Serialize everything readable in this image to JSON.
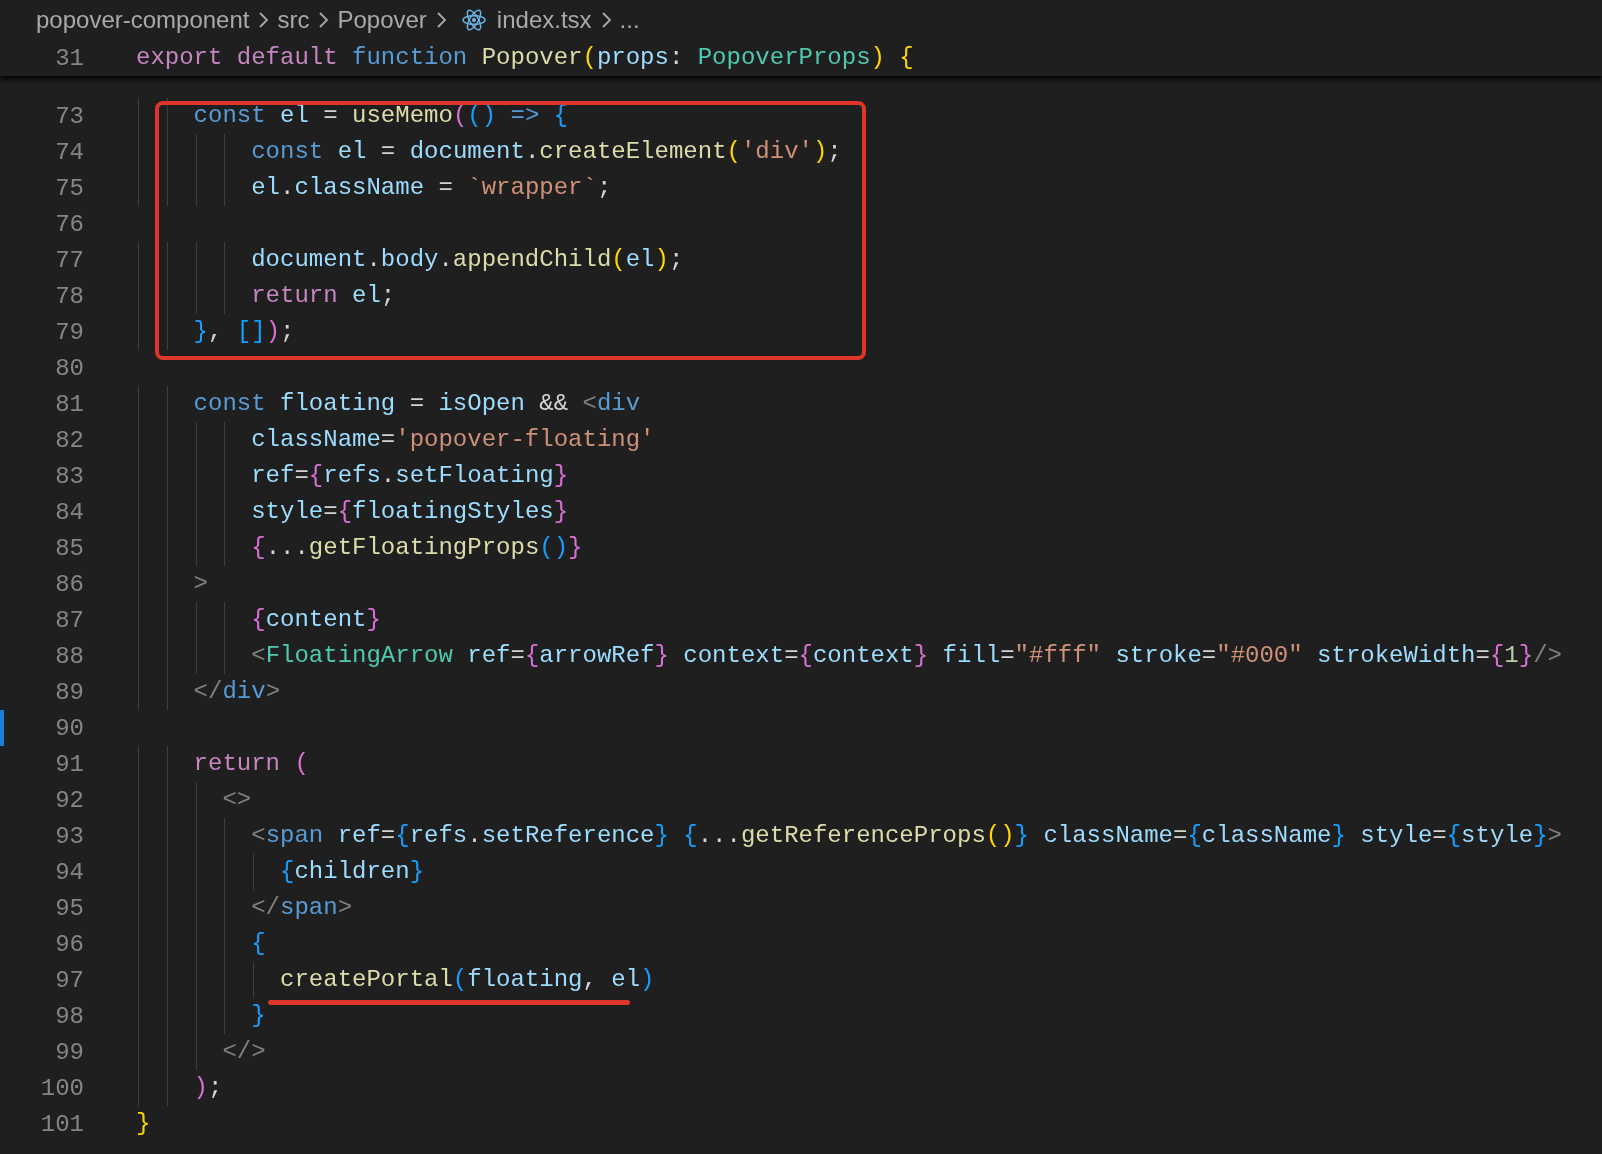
{
  "breadcrumb": [
    {
      "kind": "folder",
      "label": "popover-component"
    },
    {
      "kind": "folder",
      "label": "src"
    },
    {
      "kind": "folder",
      "label": "Popover"
    },
    {
      "kind": "file",
      "label": "index.tsx"
    },
    {
      "kind": "more",
      "label": "..."
    }
  ],
  "sticky_line": {
    "number": "31",
    "changed": false,
    "tokens": [
      {
        "kind": "ctl",
        "text": "export default"
      },
      {
        "kind": "kw",
        "text": " function"
      },
      {
        "kind": "fn",
        "text": " Popover"
      },
      {
        "kind": "b1",
        "text": "("
      },
      {
        "kind": "var",
        "text": "props"
      },
      {
        "kind": "txt",
        "text": ":"
      },
      {
        "kind": "type",
        "text": " PopoverProps"
      },
      {
        "kind": "b1",
        "text": ")"
      },
      {
        "kind": "b1",
        "text": " {"
      }
    ]
  },
  "lines": [
    {
      "number": "73",
      "changed": false,
      "tokens": [
        {
          "kind": "kw",
          "text": "    const"
        },
        {
          "kind": "var",
          "text": " el"
        },
        {
          "kind": "txt",
          "text": " = "
        },
        {
          "kind": "fn",
          "text": "useMemo"
        },
        {
          "kind": "b2",
          "text": "("
        },
        {
          "kind": "b3",
          "text": "()"
        },
        {
          "kind": "kw",
          "text": " =>"
        },
        {
          "kind": "b3",
          "text": " {"
        }
      ]
    },
    {
      "number": "74",
      "changed": false,
      "tokens": [
        {
          "kind": "kw",
          "text": "        const"
        },
        {
          "kind": "var",
          "text": " el"
        },
        {
          "kind": "txt",
          "text": " = "
        },
        {
          "kind": "var",
          "text": "document"
        },
        {
          "kind": "txt",
          "text": "."
        },
        {
          "kind": "fn",
          "text": "createElement"
        },
        {
          "kind": "b1",
          "text": "("
        },
        {
          "kind": "str",
          "text": "'div'"
        },
        {
          "kind": "b1",
          "text": ")"
        },
        {
          "kind": "txt",
          "text": ";"
        }
      ]
    },
    {
      "number": "75",
      "changed": false,
      "tokens": [
        {
          "kind": "var",
          "text": "        el"
        },
        {
          "kind": "txt",
          "text": "."
        },
        {
          "kind": "var",
          "text": "className"
        },
        {
          "kind": "txt",
          "text": " = "
        },
        {
          "kind": "str",
          "text": "`wrapper`"
        },
        {
          "kind": "txt",
          "text": ";"
        }
      ]
    },
    {
      "number": "76",
      "changed": false
    },
    {
      "number": "77",
      "changed": false,
      "tokens": [
        {
          "kind": "var",
          "text": "        document"
        },
        {
          "kind": "txt",
          "text": "."
        },
        {
          "kind": "var",
          "text": "body"
        },
        {
          "kind": "txt",
          "text": "."
        },
        {
          "kind": "fn",
          "text": "appendChild"
        },
        {
          "kind": "b1",
          "text": "("
        },
        {
          "kind": "var",
          "text": "el"
        },
        {
          "kind": "b1",
          "text": ")"
        },
        {
          "kind": "txt",
          "text": ";"
        }
      ]
    },
    {
      "number": "78",
      "changed": false,
      "tokens": [
        {
          "kind": "ctl",
          "text": "        return"
        },
        {
          "kind": "var",
          "text": " el"
        },
        {
          "kind": "txt",
          "text": ";"
        }
      ]
    },
    {
      "number": "79",
      "changed": false,
      "tokens": [
        {
          "kind": "b3",
          "text": "    }"
        },
        {
          "kind": "txt",
          "text": ","
        },
        {
          "kind": "b3",
          "text": " []"
        },
        {
          "kind": "b2",
          "text": ")"
        },
        {
          "kind": "txt",
          "text": ";"
        }
      ]
    },
    {
      "number": "80",
      "changed": false
    },
    {
      "number": "81",
      "changed": false,
      "tokens": [
        {
          "kind": "kw",
          "text": "    const"
        },
        {
          "kind": "var",
          "text": " floating"
        },
        {
          "kind": "txt",
          "text": " = "
        },
        {
          "kind": "var",
          "text": "isOpen"
        },
        {
          "kind": "txt",
          "text": " && "
        },
        {
          "kind": "tag",
          "text": "<"
        },
        {
          "kind": "html",
          "text": "div"
        }
      ]
    },
    {
      "number": "82",
      "changed": false,
      "tokens": [
        {
          "kind": "attr",
          "text": "        className"
        },
        {
          "kind": "txt",
          "text": "="
        },
        {
          "kind": "str",
          "text": "'popover-floating'"
        }
      ]
    },
    {
      "number": "83",
      "changed": false,
      "tokens": [
        {
          "kind": "attr",
          "text": "        ref"
        },
        {
          "kind": "txt",
          "text": "="
        },
        {
          "kind": "b2",
          "text": "{"
        },
        {
          "kind": "var",
          "text": "refs"
        },
        {
          "kind": "txt",
          "text": "."
        },
        {
          "kind": "var",
          "text": "setFloating"
        },
        {
          "kind": "b2",
          "text": "}"
        }
      ]
    },
    {
      "number": "84",
      "changed": false,
      "tokens": [
        {
          "kind": "attr",
          "text": "        style"
        },
        {
          "kind": "txt",
          "text": "="
        },
        {
          "kind": "b2",
          "text": "{"
        },
        {
          "kind": "var",
          "text": "floatingStyles"
        },
        {
          "kind": "b2",
          "text": "}"
        }
      ]
    },
    {
      "number": "85",
      "changed": false,
      "tokens": [
        {
          "kind": "b2",
          "text": "        {"
        },
        {
          "kind": "txt",
          "text": "..."
        },
        {
          "kind": "fn",
          "text": "getFloatingProps"
        },
        {
          "kind": "b3",
          "text": "()"
        },
        {
          "kind": "b2",
          "text": "}"
        }
      ]
    },
    {
      "number": "86",
      "changed": false,
      "tokens": [
        {
          "kind": "tag",
          "text": "    >"
        }
      ]
    },
    {
      "number": "87",
      "changed": false,
      "tokens": [
        {
          "kind": "b2",
          "text": "        {"
        },
        {
          "kind": "var",
          "text": "content"
        },
        {
          "kind": "b2",
          "text": "}"
        }
      ]
    },
    {
      "number": "88",
      "changed": false,
      "tokens": [
        {
          "kind": "tag",
          "text": "        <"
        },
        {
          "kind": "type",
          "text": "FloatingArrow"
        },
        {
          "kind": "attr",
          "text": " ref"
        },
        {
          "kind": "txt",
          "text": "="
        },
        {
          "kind": "b2",
          "text": "{"
        },
        {
          "kind": "var",
          "text": "arrowRef"
        },
        {
          "kind": "b2",
          "text": "}"
        },
        {
          "kind": "attr",
          "text": " context"
        },
        {
          "kind": "txt",
          "text": "="
        },
        {
          "kind": "b2",
          "text": "{"
        },
        {
          "kind": "var",
          "text": "context"
        },
        {
          "kind": "b2",
          "text": "}"
        },
        {
          "kind": "attr",
          "text": " fill"
        },
        {
          "kind": "txt",
          "text": "="
        },
        {
          "kind": "str",
          "text": "\"#fff\""
        },
        {
          "kind": "attr",
          "text": " stroke"
        },
        {
          "kind": "txt",
          "text": "="
        },
        {
          "kind": "str",
          "text": "\"#000\""
        },
        {
          "kind": "attr",
          "text": " strokeWidth"
        },
        {
          "kind": "txt",
          "text": "="
        },
        {
          "kind": "b2",
          "text": "{"
        },
        {
          "kind": "num",
          "text": "1"
        },
        {
          "kind": "b2",
          "text": "}"
        },
        {
          "kind": "tag",
          "text": "/>"
        }
      ]
    },
    {
      "number": "89",
      "changed": false,
      "tokens": [
        {
          "kind": "tag",
          "text": "    </"
        },
        {
          "kind": "html",
          "text": "div"
        },
        {
          "kind": "tag",
          "text": ">"
        }
      ]
    },
    {
      "number": "90",
      "changed": true
    },
    {
      "number": "91",
      "changed": false,
      "tokens": [
        {
          "kind": "ctl",
          "text": "    return"
        },
        {
          "kind": "b2",
          "text": " ("
        }
      ]
    },
    {
      "number": "92",
      "changed": false,
      "tokens": [
        {
          "kind": "tag",
          "text": "      <>"
        }
      ]
    },
    {
      "number": "93",
      "changed": false,
      "tokens": [
        {
          "kind": "tag",
          "text": "        <"
        },
        {
          "kind": "html",
          "text": "span"
        },
        {
          "kind": "attr",
          "text": " ref"
        },
        {
          "kind": "txt",
          "text": "="
        },
        {
          "kind": "b3",
          "text": "{"
        },
        {
          "kind": "var",
          "text": "refs"
        },
        {
          "kind": "txt",
          "text": "."
        },
        {
          "kind": "var",
          "text": "setReference"
        },
        {
          "kind": "b3",
          "text": "}"
        },
        {
          "kind": "b3",
          "text": " {"
        },
        {
          "kind": "txt",
          "text": "..."
        },
        {
          "kind": "fn",
          "text": "getReferenceProps"
        },
        {
          "kind": "b1",
          "text": "()"
        },
        {
          "kind": "b3",
          "text": "}"
        },
        {
          "kind": "attr",
          "text": " className"
        },
        {
          "kind": "txt",
          "text": "="
        },
        {
          "kind": "b3",
          "text": "{"
        },
        {
          "kind": "var",
          "text": "className"
        },
        {
          "kind": "b3",
          "text": "}"
        },
        {
          "kind": "attr",
          "text": " style"
        },
        {
          "kind": "txt",
          "text": "="
        },
        {
          "kind": "b3",
          "text": "{"
        },
        {
          "kind": "var",
          "text": "style"
        },
        {
          "kind": "b3",
          "text": "}"
        },
        {
          "kind": "tag",
          "text": ">"
        }
      ]
    },
    {
      "number": "94",
      "changed": false,
      "tokens": [
        {
          "kind": "b3",
          "text": "          {"
        },
        {
          "kind": "var",
          "text": "children"
        },
        {
          "kind": "b3",
          "text": "}"
        }
      ]
    },
    {
      "number": "95",
      "changed": false,
      "tokens": [
        {
          "kind": "tag",
          "text": "        </"
        },
        {
          "kind": "html",
          "text": "span"
        },
        {
          "kind": "tag",
          "text": ">"
        }
      ]
    },
    {
      "number": "96",
      "changed": false,
      "tokens": [
        {
          "kind": "b3",
          "text": "        {"
        }
      ]
    },
    {
      "number": "97",
      "changed": false,
      "tokens": [
        {
          "kind": "fn",
          "text": "          createPortal"
        },
        {
          "kind": "b3",
          "text": "("
        },
        {
          "kind": "var",
          "text": "floating"
        },
        {
          "kind": "txt",
          "text": ","
        },
        {
          "kind": "var",
          "text": " el"
        },
        {
          "kind": "b3",
          "text": ")"
        }
      ]
    },
    {
      "number": "98",
      "changed": false,
      "tokens": [
        {
          "kind": "b3",
          "text": "        }"
        }
      ]
    },
    {
      "number": "99",
      "changed": false,
      "tokens": [
        {
          "kind": "tag",
          "text": "      </>"
        }
      ]
    },
    {
      "number": "100",
      "changed": false,
      "tokens": [
        {
          "kind": "b2",
          "text": "    )"
        },
        {
          "kind": "txt",
          "text": ";"
        }
      ]
    },
    {
      "number": "101",
      "changed": false,
      "tokens": [
        {
          "kind": "b1",
          "text": "}"
        }
      ]
    }
  ],
  "annotations": [
    {
      "kind": "box"
    },
    {
      "kind": "underline"
    }
  ]
}
